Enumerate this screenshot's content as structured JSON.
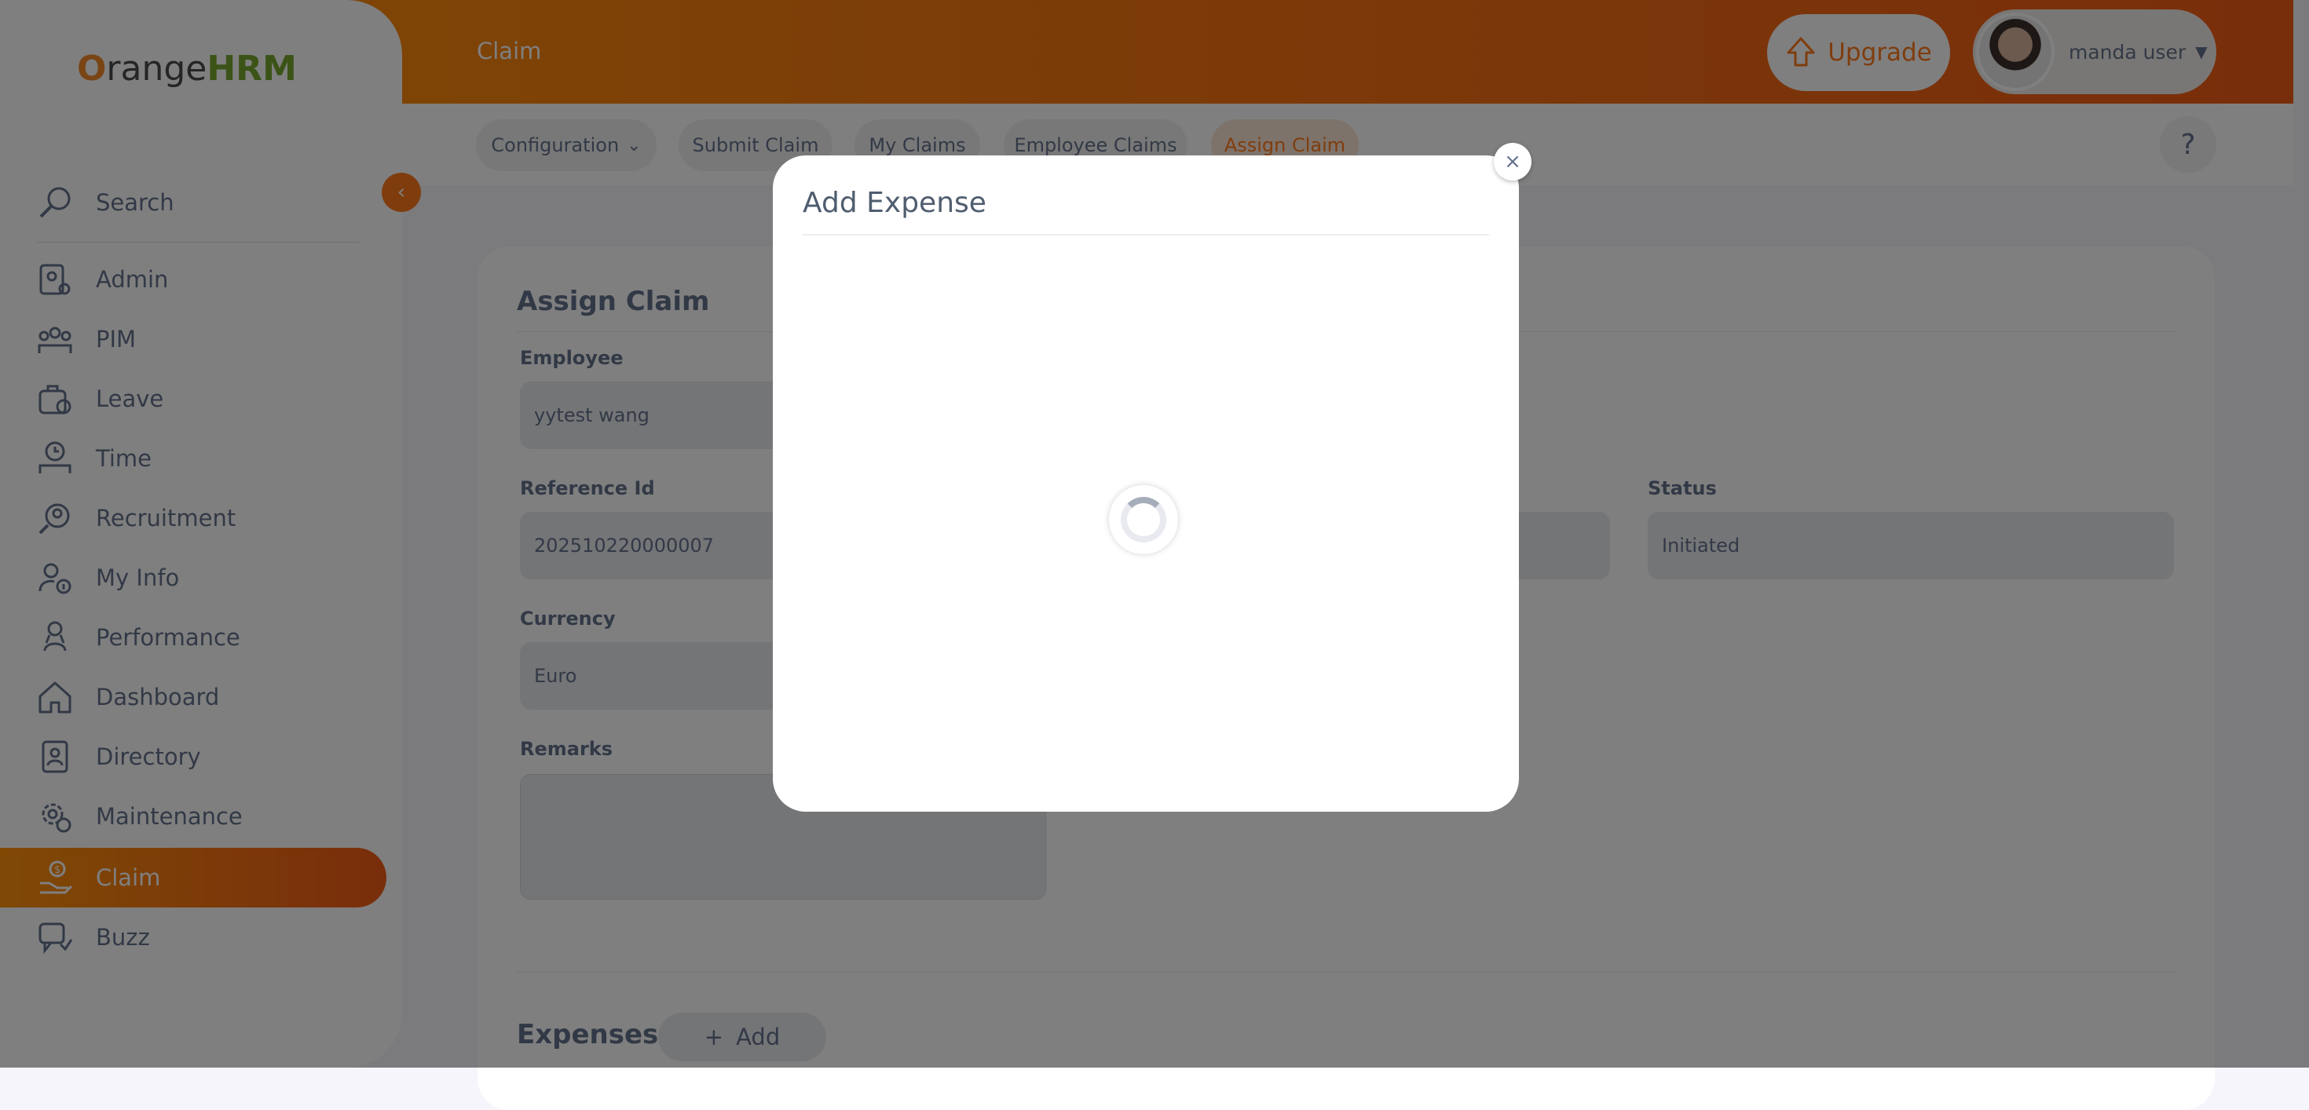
{
  "topbar": {
    "module_title": "Claim",
    "upgrade_label": "Upgrade",
    "user_name": "manda user"
  },
  "topnav": {
    "tabs": [
      {
        "label": "Configuration",
        "has_dropdown": true
      },
      {
        "label": "Submit Claim"
      },
      {
        "label": "My Claims"
      },
      {
        "label": "Employee Claims"
      },
      {
        "label": "Assign Claim",
        "active": true
      }
    ],
    "help_label": "?"
  },
  "sidebar": {
    "logo_text_prefix": "O",
    "logo_text_mid": "range",
    "logo_text_suffix": "HRM",
    "collapse_icon": "chevron-left-icon",
    "items": [
      {
        "label": "Search",
        "icon": "search-icon"
      },
      {
        "label": "Admin",
        "icon": "admin-icon"
      },
      {
        "label": "PIM",
        "icon": "pim-icon"
      },
      {
        "label": "Leave",
        "icon": "leave-icon"
      },
      {
        "label": "Time",
        "icon": "time-icon"
      },
      {
        "label": "Recruitment",
        "icon": "recruitment-icon"
      },
      {
        "label": "My Info",
        "icon": "myinfo-icon"
      },
      {
        "label": "Performance",
        "icon": "performance-icon"
      },
      {
        "label": "Dashboard",
        "icon": "dashboard-icon"
      },
      {
        "label": "Directory",
        "icon": "directory-icon"
      },
      {
        "label": "Maintenance",
        "icon": "maintenance-icon"
      },
      {
        "label": "Claim",
        "icon": "claim-icon",
        "active": true
      },
      {
        "label": "Buzz",
        "icon": "buzz-icon"
      }
    ]
  },
  "form": {
    "title": "Assign Claim",
    "employee_label": "Employee",
    "employee_value": "yytest wang",
    "reference_label": "Reference Id",
    "reference_value": "202510220000007",
    "status_label": "Status",
    "status_value": "Initiated",
    "currency_label": "Currency",
    "currency_value": "Euro",
    "remarks_label": "Remarks",
    "remarks_value": "",
    "expenses_title": "Expenses",
    "add_label": "Add"
  },
  "modal": {
    "title": "Add Expense",
    "close_label": "×",
    "state": "loading"
  },
  "colors": {
    "brand_orange": "#ff7b1d",
    "gradient_start": "#ff920b",
    "gradient_end": "#f35c17"
  }
}
